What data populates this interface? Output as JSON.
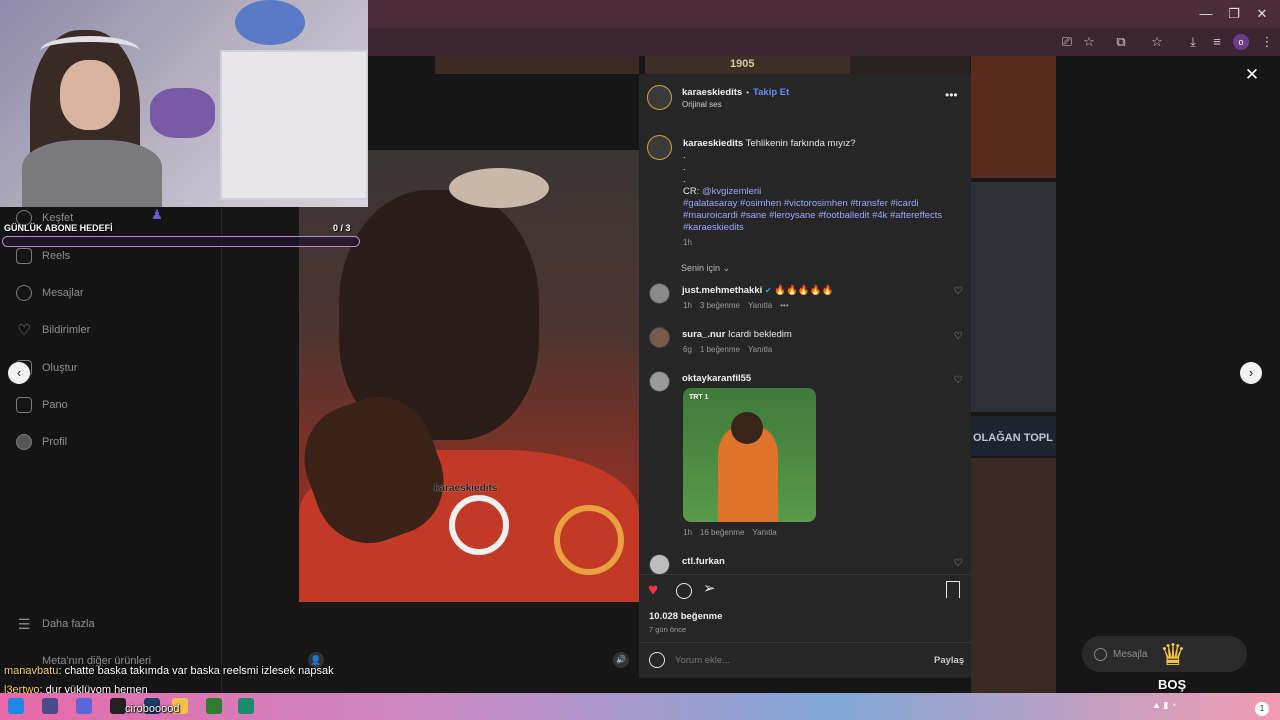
{
  "browser": {
    "colors": {
      "titlebar": "#4a2c3a",
      "toolbar": "#3b2531"
    },
    "window_controls": [
      "minimize-icon",
      "restore-icon",
      "close-icon"
    ],
    "toolbar_icons": [
      "cast-icon",
      "star-icon",
      "extensions-icon",
      "bookmark-icon",
      "download-icon",
      "menu-icon"
    ],
    "profile_badge": "o"
  },
  "sidebar": {
    "items": [
      {
        "label": "Keşfet",
        "icon": "explore-icon"
      },
      {
        "label": "Reels",
        "icon": "reels-icon"
      },
      {
        "label": "Mesajlar",
        "icon": "messenger-icon"
      },
      {
        "label": "Bildirimler",
        "icon": "heart-icon"
      },
      {
        "label": "Oluştur",
        "icon": "create-icon"
      },
      {
        "label": "Pano",
        "icon": "dashboard-icon"
      },
      {
        "label": "Profil",
        "icon": "profile-icon"
      }
    ],
    "more": "Daha fazla",
    "meta": "Meta'nın diğer ürünleri"
  },
  "stream_overlay": {
    "goal_title": "GÜNLÜK ABONE HEDEFİ",
    "goal_value": "0 / 3",
    "chat": [
      {
        "user": "manavbatu",
        "text": "chatte baska takımda var baska reelsmi izlesek napsak"
      },
      {
        "user": "l3ertwo",
        "text": "dur yüklüyom hemen"
      },
      {
        "user": "",
        "text": "cirobooood"
      }
    ],
    "badge_text": "BOŞ",
    "messages_pill": "Mesajla"
  },
  "background": {
    "year_text": "1905",
    "banner_text": "OLAĞAN TOPL"
  },
  "video": {
    "watermark": "karaeskiedits"
  },
  "post": {
    "author": "karaeskiedits",
    "follow": "Takip Et",
    "audio": "Orijinal ses",
    "caption": {
      "user": "karaeskiedits",
      "text": "Tehlikenin farkında mıyız?",
      "dots": [
        ".",
        ".",
        "."
      ],
      "cr_label": "CR:",
      "cr_handle": "@kvgizemlerii",
      "hashtags": "#galatasaray #osimhen #victorosimhen #transfer #icardi #mauroicardi #sane #leroysane #footballedit #4k #aftereffects #karaeskiedits",
      "time": "1h"
    },
    "sort_label": "Senin için",
    "comments": [
      {
        "user": "just.mehmethakki",
        "verified": true,
        "text": "🔥🔥🔥🔥🔥",
        "time": "1h",
        "likes": "3 beğenme",
        "reply": "Yanıtla",
        "more": "•••"
      },
      {
        "user": "sura_.nur",
        "verified": false,
        "text": "Icardi bekledim",
        "time": "6g",
        "likes": "1 beğenme",
        "reply": "Yanıtla"
      },
      {
        "user": "oktaykaranfil55",
        "verified": false,
        "text": "",
        "image_label": "TRT 1",
        "time": "1h",
        "likes": "16 beğenme",
        "reply": "Yanıtla"
      },
      {
        "user": "ctl.furkan",
        "verified": false,
        "text": ""
      }
    ],
    "likes": "10.028 beğenme",
    "posted": "7 gün önce",
    "comment_placeholder": "Yorum ekle...",
    "share_button": "Paylaş"
  },
  "colors": {
    "accent_link": "#9aa9ff",
    "like_red": "#ff3040",
    "panel": "#262626"
  }
}
